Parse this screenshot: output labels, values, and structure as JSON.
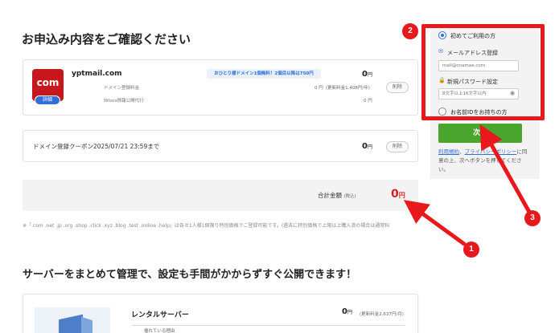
{
  "page": {
    "title": "お申込み内容をご確認ください",
    "section2_title": "サーバーをまとめて管理で、設定も手間がかからずすぐ公開できます！"
  },
  "order": {
    "tld_tile": "com",
    "detail_badge": "詳細",
    "domain": "yptmail.com",
    "campaign": "おひとり様ドメイン1個無料！2個目以降は750円",
    "price": "0",
    "yen": "円",
    "line1_label": "ドメイン登録料金",
    "line1_price": "0 円",
    "line1_note": "(更新料金1,408円/年)",
    "line2_label": "Whois情報公開代行",
    "line2_price": "0 円",
    "delete": "削除"
  },
  "coupon": {
    "label": "ドメイン登録クーポン2025/07/21 23:59まで",
    "price": "0",
    "yen": "円",
    "delete": "削除"
  },
  "total": {
    "label": "合計金額",
    "tax": "(税込)",
    "value": "0",
    "yen": "円"
  },
  "footnote": "※「.com .net .jp .org .shop .click .xyz .blog .test .online .help」は各々1人様1個限り特別価格でご登録可能です。(過去に特別価格で上限以上購入済の場合は通常料",
  "server": {
    "title": "レンタルサーバー",
    "price": "0",
    "yen": "円",
    "note": "(更新料金2,637円/月)",
    "reason": "優れている理由"
  },
  "sidebar": {
    "first_time": "初めてご利用の方",
    "email_label": "メールアドレス登録",
    "email_placeholder": "mail@onamae.com",
    "password_label": "新規パスワード設定",
    "password_placeholder": "8文字以上16文字以内",
    "existing": "お名前IDをお持ちの方",
    "next": "次へ",
    "terms_link1": "利用規約",
    "terms_mid": "、",
    "terms_link2": "プライバシーポリシー",
    "terms_rest": "に同意の上、次へボタンを押してください。"
  },
  "annotations": {
    "m1": "1",
    "m2": "2",
    "m3": "3",
    "color": "#e8191c"
  }
}
